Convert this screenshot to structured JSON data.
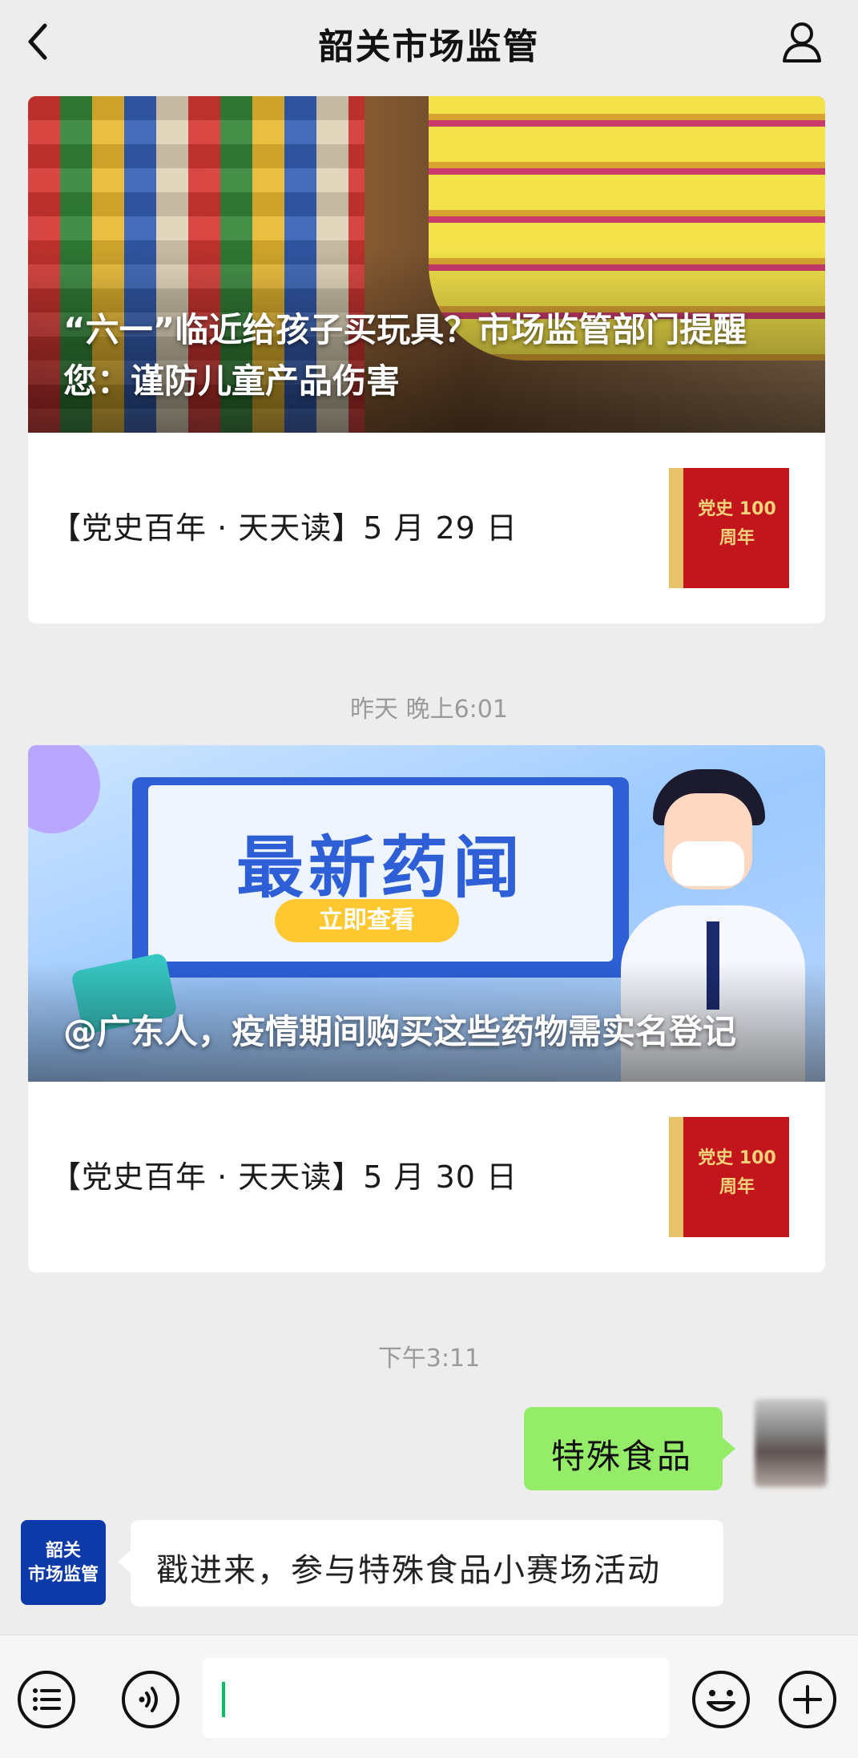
{
  "header": {
    "title": "韶关市场监管"
  },
  "messages": {
    "card1": {
      "cover_title": "“六一”临近给孩子买玩具？市场监管部门提醒您：谨防儿童产品伤害",
      "sub_title": "【党史百年 · 天天读】5 月 29 日",
      "thumb_label": "党史 100 周年"
    },
    "time1": "昨天 晚上6:01",
    "card2": {
      "banner_title": "最新药闻",
      "banner_button": "立即查看",
      "cover_title": "@广东人，疫情期间购买这些药物需实名登记",
      "sub_title": "【党史百年 · 天天读】5 月 30 日",
      "thumb_label": "党史 100 周年"
    },
    "time2": "下午3:11",
    "outgoing": "特殊食品",
    "bot_avatar_line1": "韶关",
    "bot_avatar_line2": "市场监管",
    "incoming": "戳进来，参与特殊食品小赛场活动"
  },
  "icons": {
    "back": "chevron-left-icon",
    "profile": "person-icon",
    "menu": "list-icon",
    "voice": "voice-icon",
    "emoji": "emoji-icon",
    "add": "plus-icon"
  },
  "colors": {
    "background": "#ededed",
    "bubble_out": "#95ec69",
    "bubble_in": "#ffffff",
    "bot_avatar": "#0c3aa8",
    "thumb": "#c3161c",
    "caret": "#07c160"
  }
}
